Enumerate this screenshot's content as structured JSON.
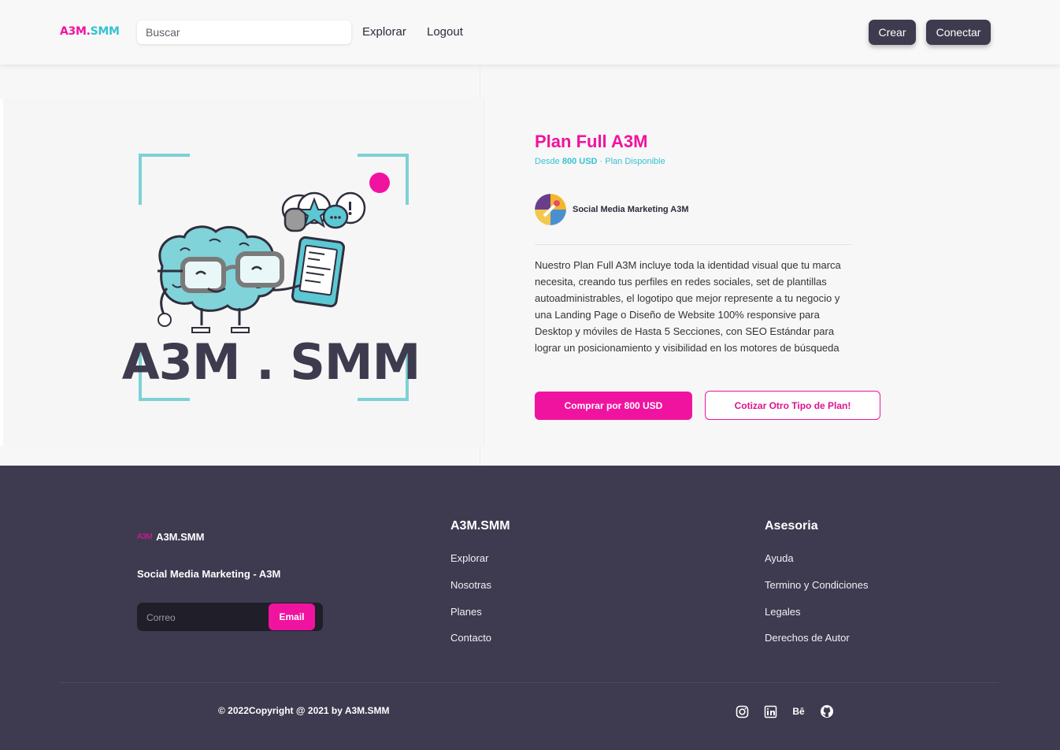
{
  "header": {
    "logo": {
      "part1": "A3M.",
      "part2": "SMM"
    },
    "search_placeholder": "Buscar",
    "nav": [
      "Explorar",
      "Logout"
    ],
    "buttons": {
      "crear": "Crear",
      "conectar": "Conectar"
    }
  },
  "hero_image": {
    "logo_text": "A3M . SMM"
  },
  "product": {
    "title": "Plan Full A3M",
    "subtitle_prefix": "Desde ",
    "price": "800 USD",
    "subtitle_suffix": " · Plan Disponible",
    "seller": "Social Media Marketing A3M",
    "description": "Nuestro Plan Full A3M incluye toda la identidad visual que tu marca necesita, creando tus perfiles en redes sociales, set de plantillas autoadministrables, el logotipo que mejor represente a tu negocio y una Landing Page o Diseño de Website 100% responsive para Desktop y móviles de Hasta 5 Secciones, con SEO Estándar para lograr un posicionamiento y visibilidad en los motores de búsqueda",
    "buy_label": "Comprar por 800 USD",
    "quote_label": "Cotizar Otro Tipo de Plan!"
  },
  "footer": {
    "brand": "A3M.SMM",
    "brand_mini": "A3M",
    "tagline": "Social Media Marketing - A3M",
    "email_placeholder": "Correo",
    "email_button": "Email",
    "col1": {
      "title": "A3M.SMM",
      "links": [
        "Explorar",
        "Nosotras",
        "Planes",
        "Contacto"
      ]
    },
    "col2": {
      "title": "Asesoria",
      "links": [
        "Ayuda",
        "Termino y Condiciones",
        "Legales",
        "Derechos de Autor"
      ]
    },
    "copyright": "© 2022Copyright @ 2021 by A3M.SMM",
    "social": [
      "instagram-icon",
      "linkedin-icon",
      "behance-icon",
      "github-icon"
    ],
    "behance_label": "Bē"
  },
  "colors": {
    "accent": "#f013a0",
    "teal": "#36c3d1",
    "dark": "#3e3a50"
  }
}
